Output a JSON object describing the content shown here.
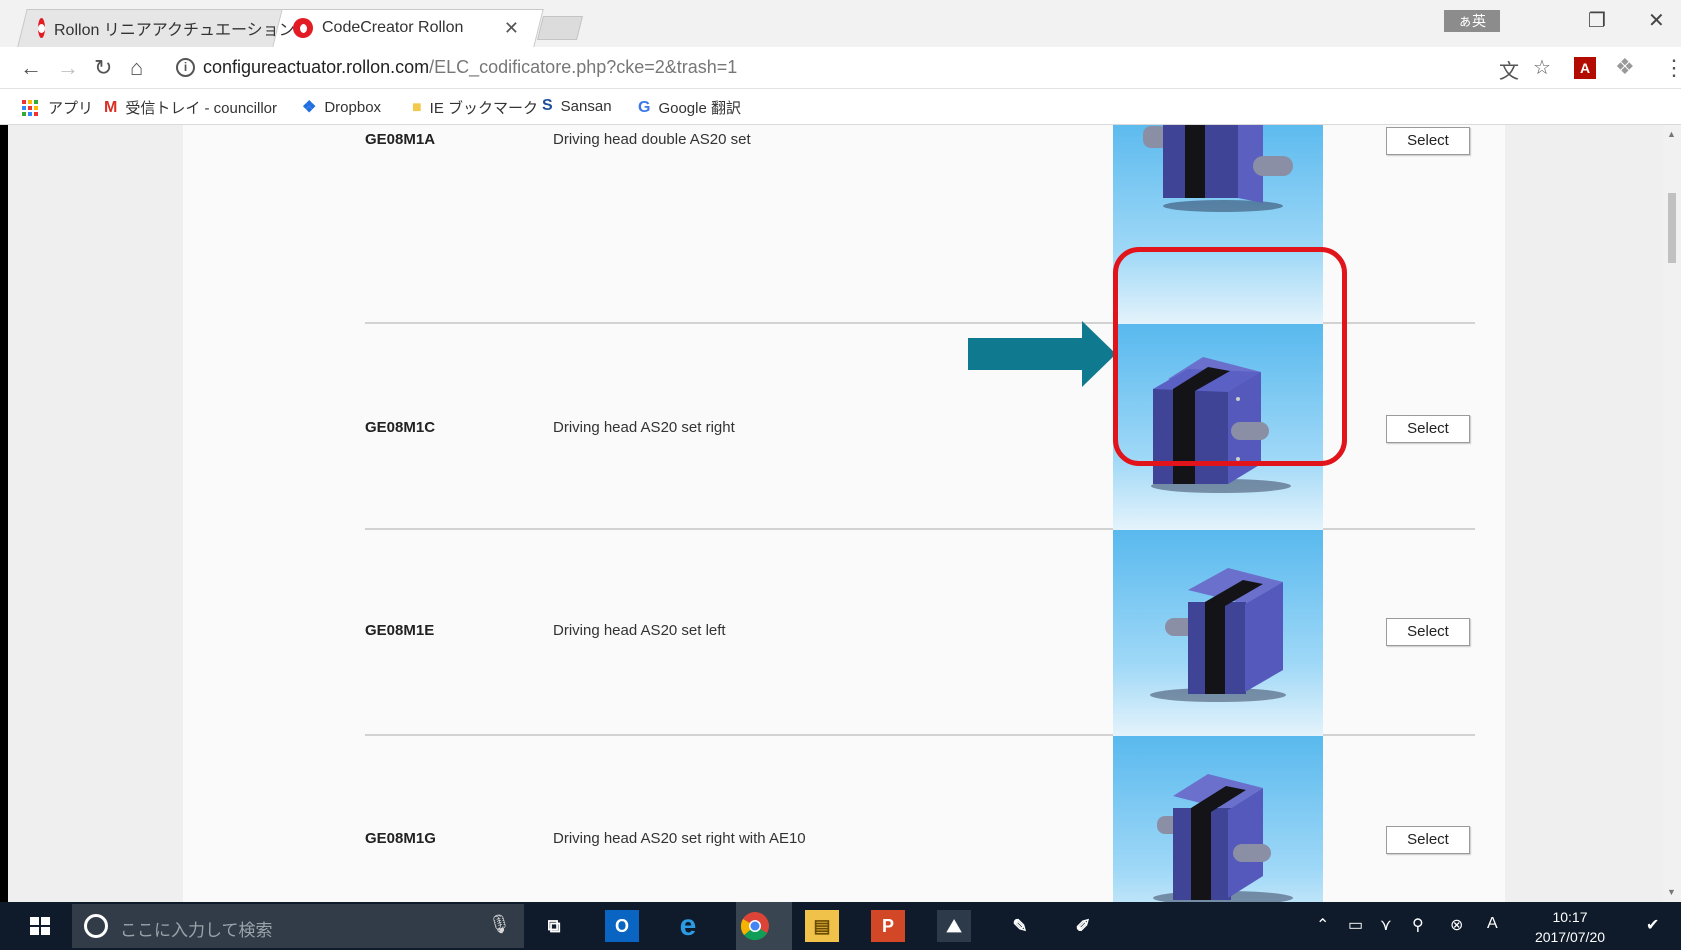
{
  "browser": {
    "tabs": [
      {
        "title": "Rollon リニアアクチュエーション",
        "active": false
      },
      {
        "title": "CodeCreator Rollon",
        "active": true
      }
    ],
    "ime_indicator": "ぁ英",
    "url_host": "configureactuator.rollon.com",
    "url_path": "/ELC_codificatore.php?cke=2&trash=1",
    "bookmarks": [
      {
        "label": "アプリ",
        "icon": "apps-grid-icon"
      },
      {
        "label": "受信トレイ - councillor",
        "icon": "gmail-icon"
      },
      {
        "label": "Dropbox",
        "icon": "dropbox-icon"
      },
      {
        "label": "IE ブックマーク",
        "icon": "folder-icon"
      },
      {
        "label": "Sansan",
        "icon": "sansan-icon"
      },
      {
        "label": "Google 翻訳",
        "icon": "google-translate-icon"
      }
    ]
  },
  "products": [
    {
      "code": "GE08M1A",
      "description": "Driving head double AS20 set",
      "button": "Select",
      "variant": "double"
    },
    {
      "code": "GE08M1C",
      "description": "Driving head AS20 set right",
      "button": "Select",
      "variant": "right",
      "highlighted": true
    },
    {
      "code": "GE08M1E",
      "description": "Driving head AS20 set left",
      "button": "Select",
      "variant": "left"
    },
    {
      "code": "GE08M1G",
      "description": "Driving head AS20 set right with AE10",
      "button": "Select",
      "variant": "right"
    }
  ],
  "annotation": {
    "highlight_color": "#e1141b",
    "arrow_color": "#0f7a8f",
    "target_code": "GE08M1C"
  },
  "taskbar": {
    "search_placeholder": "ここに入力して検索",
    "apps": [
      "task-view-icon",
      "outlook-icon",
      "internet-explorer-icon",
      "chrome-icon",
      "file-explorer-icon",
      "powerpoint-icon",
      "photos-icon",
      "paint-icon",
      "sketch-icon"
    ],
    "time": "10:17",
    "date": "2017/07/20"
  },
  "colors": {
    "thumb_top": "#59b9ee",
    "actuator_body": "#4a4fa8",
    "taskbar": "#0f1b2a"
  }
}
